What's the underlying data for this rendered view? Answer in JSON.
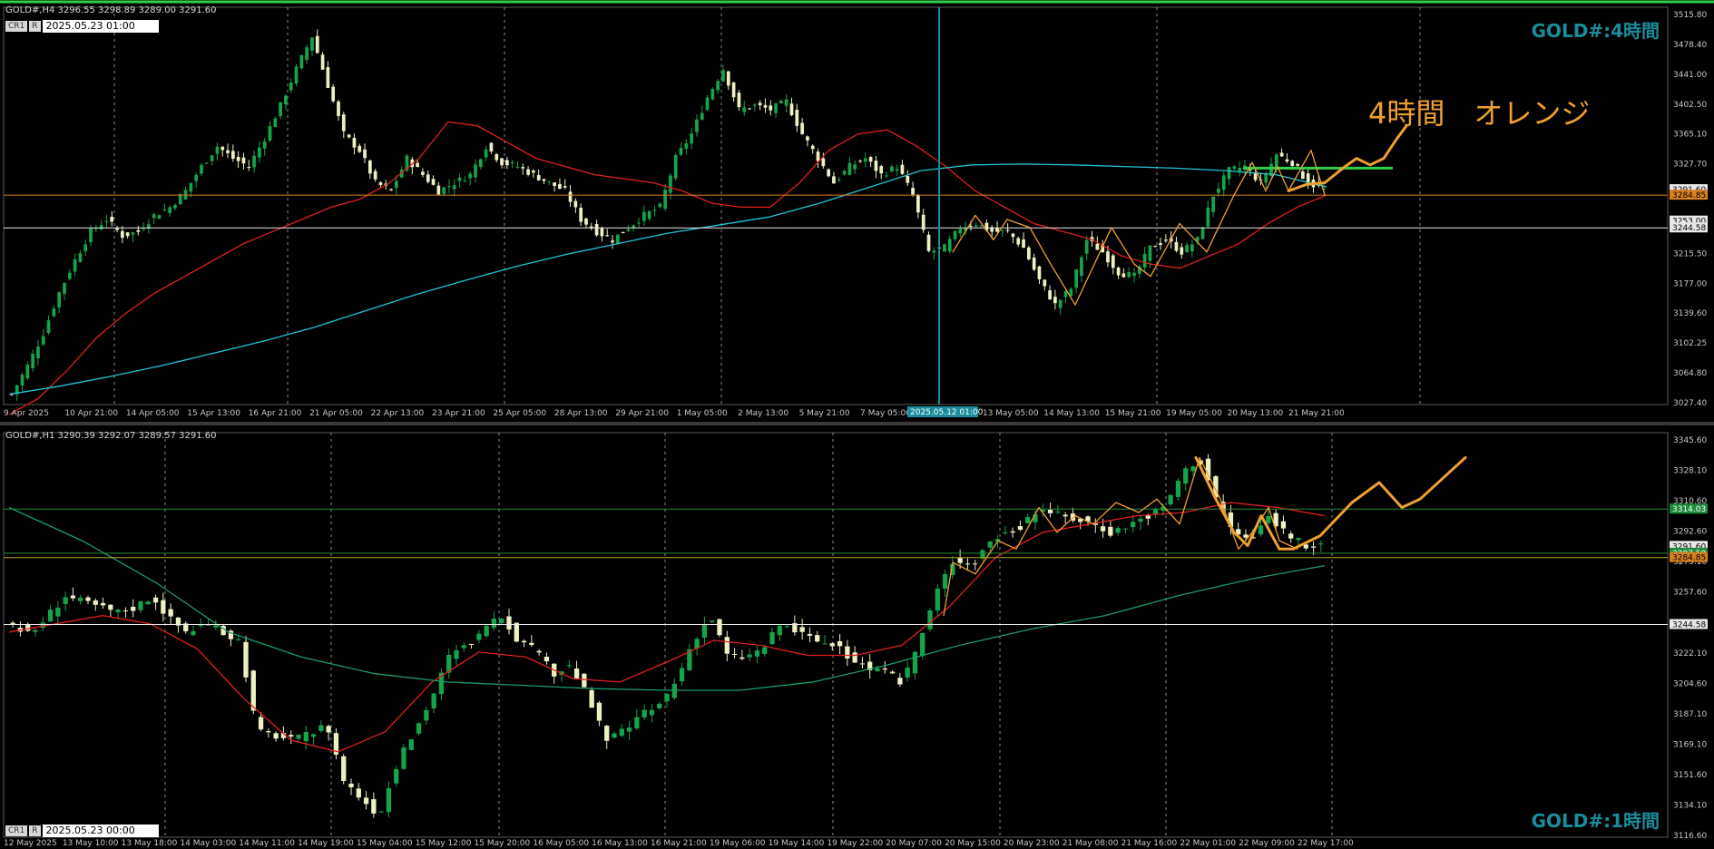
{
  "colors": {
    "background": "#000000",
    "bull_candle": "#16a34a",
    "bear_candle": "#eef0c0",
    "ma_fast": "#e02020",
    "ma_slow": "#22c4d6",
    "ma_slow_h1": "#1d9a6c",
    "drawing": "#f0a030",
    "hline_orange": "#d98020",
    "hline_white": "#e8e8e8",
    "hline_green": "#2fd04a",
    "hline_green_h1": "#1f8a3a",
    "hline_yellow_h1": "#b8a020",
    "cursor_line": "#1a8c9c",
    "watermark": "#1a8c9c"
  },
  "h4": {
    "header": "GOLD#,H4  3296.55 3298.89 3289.00 3291.60",
    "ctrl_cr": "CR1",
    "ctrl_r": "R",
    "ctrl_date": "2025.05.23 01:00",
    "watermark": "GOLD#:4時間",
    "annotation": "4時間　オレンジ",
    "cursor_label": "2025.05.12 01:00",
    "price_labels": [
      "3515.80",
      "3478.40",
      "3441.00",
      "3402.50",
      "3365.10",
      "3327.70",
      "3289.20",
      "3251.85",
      "3215.50",
      "3177.00",
      "3139.60",
      "3102.25",
      "3064.80",
      "3027.40"
    ],
    "line_tags": {
      "orange": "3284.85",
      "white": "3244.58",
      "tag_a": "3291.60",
      "tag_b": "3253.00"
    },
    "x_labels": [
      "9 Apr 2025",
      "10 Apr 21:00",
      "14 Apr 05:00",
      "15 Apr 13:00",
      "16 Apr 21:00",
      "21 Apr 05:00",
      "22 Apr 13:00",
      "23 Apr 21:00",
      "25 Apr 05:00",
      "28 Apr 13:00",
      "29 Apr 21:00",
      "1 May 05:00",
      "2 May 13:00",
      "5 May 21:00",
      "7 May 05:00",
      "8 May 13:00",
      "13 May 05:00",
      "14 May 13:00",
      "15 May 21:00",
      "19 May 05:00",
      "20 May 13:00",
      "21 May 21:00"
    ]
  },
  "h1": {
    "header": "GOLD#,H1  3290.39 3292.07 3289.57 3291.60",
    "ctrl_cr": "CR1",
    "ctrl_r": "R",
    "ctrl_date": "2025.05.23 00:00",
    "watermark": "GOLD#:1時間",
    "price_labels": [
      "3345.60",
      "3328.10",
      "3310.60",
      "3292.60",
      "3275.10",
      "3257.60",
      "3240.10",
      "3222.10",
      "3204.60",
      "3187.10",
      "3169.10",
      "3151.60",
      "3134.10",
      "3116.60"
    ],
    "line_tags": {
      "green": "3314.03",
      "white": "3244.58",
      "tag_a": "3291.60",
      "tag_b": "3287.50",
      "tag_c": "3284.85"
    },
    "x_labels": [
      "12 May 2025",
      "13 May 10:00",
      "13 May 18:00",
      "14 May 03:00",
      "14 May 11:00",
      "14 May 19:00",
      "15 May 04:00",
      "15 May 12:00",
      "15 May 20:00",
      "16 May 05:00",
      "16 May 13:00",
      "16 May 21:00",
      "19 May 06:00",
      "19 May 14:00",
      "19 May 22:00",
      "20 May 07:00",
      "20 May 15:00",
      "20 May 23:00",
      "21 May 08:00",
      "21 May 16:00",
      "22 May 01:00",
      "22 May 09:00",
      "22 May 17:00"
    ]
  },
  "chart_data": [
    {
      "type": "candlestick",
      "title": "GOLD#,H4",
      "ylim": [
        3027.4,
        3515.8
      ],
      "approx_close_path": [
        3040,
        3075,
        3115,
        3165,
        3205,
        3240,
        3255,
        3235,
        3240,
        3260,
        3270,
        3290,
        3320,
        3345,
        3330,
        3320,
        3355,
        3395,
        3440,
        3480,
        3420,
        3360,
        3340,
        3300,
        3290,
        3330,
        3310,
        3290,
        3300,
        3310,
        3345,
        3325,
        3320,
        3310,
        3300,
        3290,
        3255,
        3240,
        3230,
        3245,
        3260,
        3270,
        3330,
        3360,
        3405,
        3440,
        3390,
        3395,
        3390,
        3400,
        3360,
        3330,
        3300,
        3320,
        3330,
        3310,
        3320,
        3285,
        3215,
        3220,
        3245,
        3250,
        3240,
        3240,
        3220,
        3180,
        3150,
        3170,
        3230,
        3215,
        3190,
        3185,
        3220,
        3230,
        3215,
        3230,
        3285,
        3315,
        3320,
        3300,
        3335,
        3325,
        3300,
        3291.6
      ],
      "series": [
        {
          "name": "ma_fast",
          "values": [
            3015,
            3035,
            3070,
            3110,
            3140,
            3165,
            3185,
            3205,
            3225,
            3240,
            3255,
            3270,
            3280,
            3300,
            3330,
            3375,
            3370,
            3350,
            3330,
            3320,
            3310,
            3305,
            3300,
            3290,
            3275,
            3270,
            3270,
            3300,
            3340,
            3360,
            3365,
            3345,
            3320,
            3290,
            3270,
            3250,
            3240,
            3230,
            3210,
            3200,
            3195,
            3210,
            3225,
            3250,
            3270,
            3285
          ]
        },
        {
          "name": "ma_slow",
          "values": [
            3040,
            3050,
            3062,
            3075,
            3090,
            3105,
            3122,
            3142,
            3162,
            3180,
            3197,
            3212,
            3225,
            3238,
            3248,
            3258,
            3275,
            3295,
            3315,
            3322,
            3323,
            3322,
            3320,
            3318,
            3315,
            3310,
            3295
          ]
        }
      ],
      "hlines": [
        3284.85,
        3244.58,
        3318
      ],
      "cursor_x": "2025.05.12 01:00"
    },
    {
      "type": "candlestick",
      "title": "GOLD#,H1",
      "ylim": [
        3116.6,
        3360
      ],
      "approx_close_path": [
        3245,
        3238,
        3250,
        3262,
        3258,
        3255,
        3252,
        3255,
        3262,
        3248,
        3240,
        3245,
        3240,
        3235,
        3180,
        3178,
        3175,
        3178,
        3185,
        3150,
        3140,
        3130,
        3160,
        3180,
        3200,
        3225,
        3232,
        3240,
        3250,
        3235,
        3228,
        3215,
        3220,
        3200,
        3175,
        3180,
        3190,
        3195,
        3210,
        3235,
        3250,
        3225,
        3225,
        3230,
        3245,
        3240,
        3235,
        3232,
        3225,
        3218,
        3215,
        3210,
        3235,
        3265,
        3285,
        3280,
        3295,
        3300,
        3305,
        3315,
        3310,
        3308,
        3305,
        3300,
        3305,
        3310,
        3315,
        3335,
        3345,
        3320,
        3300,
        3295,
        3310,
        3300,
        3292,
        3291.6
      ],
      "series": [
        {
          "name": "ma_fast",
          "values": [
            3240,
            3245,
            3250,
            3245,
            3230,
            3200,
            3175,
            3168,
            3180,
            3210,
            3228,
            3225,
            3212,
            3210,
            3222,
            3235,
            3232,
            3226,
            3226,
            3232,
            3255,
            3285,
            3300,
            3305,
            3310,
            3312,
            3318,
            3315,
            3310
          ]
        },
        {
          "name": "ma_slow",
          "values": [
            3315,
            3295,
            3270,
            3240,
            3225,
            3215,
            3210,
            3208,
            3206,
            3205,
            3205,
            3210,
            3220,
            3232,
            3242,
            3250,
            3262,
            3272,
            3280
          ]
        }
      ],
      "hlines": [
        3314.03,
        3291.6,
        3287.5,
        3284.85,
        3244.58
      ]
    }
  ]
}
